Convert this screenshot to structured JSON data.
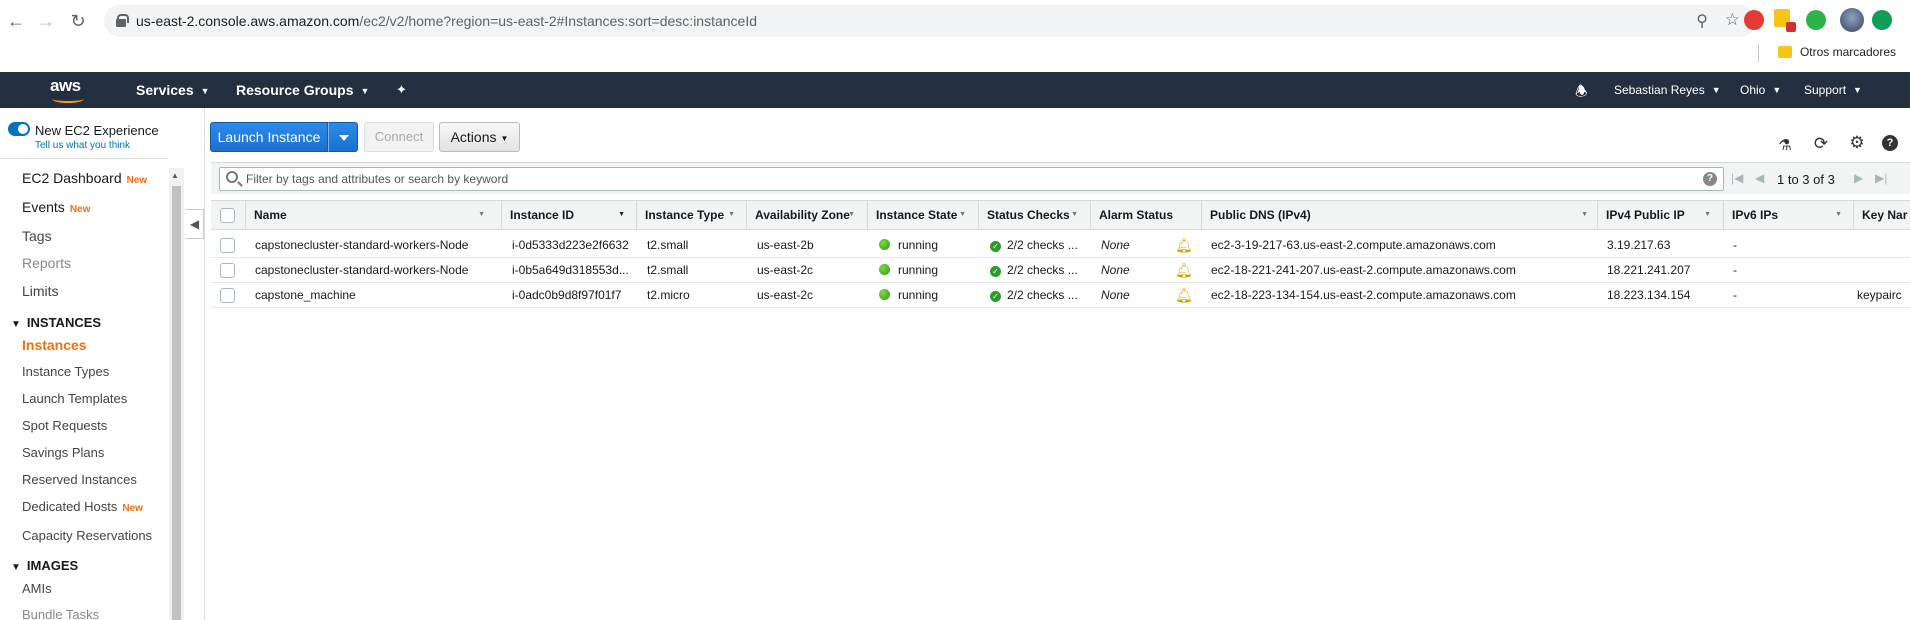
{
  "browser": {
    "url_host": "us-east-2.console.aws.amazon.com",
    "url_path": "/ec2/v2/home?region=us-east-2#Instances:sort=desc:instanceId",
    "bookmarks_folder": "Otros marcadores"
  },
  "aws_nav": {
    "logo_text": "aws",
    "services": "Services",
    "resource_groups": "Resource Groups",
    "user": "Sebastian Reyes",
    "region": "Ohio",
    "support": "Support"
  },
  "sidebar": {
    "experience_title": "New EC2 Experience",
    "experience_link": "Tell us what you think",
    "new_badge": "New",
    "items": [
      {
        "label": "EC2 Dashboard",
        "badge": "New"
      },
      {
        "label": "Events",
        "badge": "New"
      },
      {
        "label": "Tags"
      },
      {
        "label": "Reports"
      },
      {
        "label": "Limits"
      }
    ],
    "section_instances": "INSTANCES",
    "instances_items": [
      {
        "label": "Instances"
      },
      {
        "label": "Instance Types"
      },
      {
        "label": "Launch Templates"
      },
      {
        "label": "Spot Requests"
      },
      {
        "label": "Savings Plans"
      },
      {
        "label": "Reserved Instances"
      },
      {
        "label": "Dedicated Hosts",
        "badge": "New"
      },
      {
        "label": "Capacity Reservations"
      }
    ],
    "section_images": "IMAGES",
    "images_items": [
      {
        "label": "AMIs"
      },
      {
        "label": "Bundle Tasks"
      }
    ]
  },
  "toolbar": {
    "launch": "Launch Instance",
    "connect": "Connect",
    "actions": "Actions"
  },
  "filter": {
    "placeholder": "Filter by tags and attributes or search by keyword",
    "pagination": "1 to 3 of 3"
  },
  "table": {
    "columns": [
      "Name",
      "Instance ID",
      "Instance Type",
      "Availability Zone",
      "Instance State",
      "Status Checks",
      "Alarm Status",
      "Public DNS (IPv4)",
      "IPv4 Public IP",
      "IPv6 IPs",
      "Key Nar"
    ],
    "rows": [
      {
        "name": "capstonecluster-standard-workers-Node",
        "instance_id": "i-0d5333d223e2f6632",
        "type": "t2.small",
        "az": "us-east-2b",
        "state": "running",
        "checks": "2/2 checks ...",
        "alarm": "None",
        "dns": "ec2-3-19-217-63.us-east-2.compute.amazonaws.com",
        "ipv4": "3.19.217.63",
        "ipv6": "-",
        "key": ""
      },
      {
        "name": "capstonecluster-standard-workers-Node",
        "instance_id": "i-0b5a649d318553d...",
        "type": "t2.small",
        "az": "us-east-2c",
        "state": "running",
        "checks": "2/2 checks ...",
        "alarm": "None",
        "dns": "ec2-18-221-241-207.us-east-2.compute.amazonaws.com",
        "ipv4": "18.221.241.207",
        "ipv6": "-",
        "key": ""
      },
      {
        "name": "capstone_machine",
        "instance_id": "i-0adc0b9d8f97f01f7",
        "type": "t2.micro",
        "az": "us-east-2c",
        "state": "running",
        "checks": "2/2 checks ...",
        "alarm": "None",
        "dns": "ec2-18-223-134-154.us-east-2.compute.amazonaws.com",
        "ipv4": "18.223.134.154",
        "ipv6": "-",
        "key": "keypairc"
      }
    ]
  },
  "colors": {
    "aws_nav_bg": "#232f3e",
    "primary_button": "#1a6fd0",
    "active_link": "#ec7211",
    "running_green": "#3fb811"
  }
}
